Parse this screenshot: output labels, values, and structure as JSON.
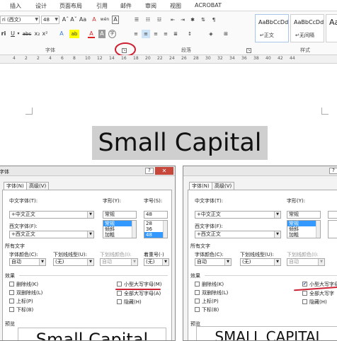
{
  "menu": {
    "tabs": [
      "插入",
      "设计",
      "页面布局",
      "引用",
      "邮件",
      "审阅",
      "视图",
      "ACROBAT"
    ]
  },
  "ribbon": {
    "font_name": "ri (西文)",
    "font_size": "48",
    "grow_font": "Aˆ",
    "shrink_font": "Aˇ",
    "change_case": "Aa",
    "clear_format": "A",
    "phonetic": "wén",
    "char_border": "A",
    "underline": "U",
    "strike": "abc",
    "subscript": "x₂",
    "superscript": "x²",
    "text_effect": "A",
    "highlight": "ab",
    "font_color": "A",
    "char_shading": "A",
    "enclose": "字",
    "group_font": "字体",
    "group_paragraph": "段落",
    "group_styles": "样式",
    "style1_sample": "AaBbCcDd",
    "style1_name": "↵正文",
    "style2_sample": "AaBbCcDd",
    "style2_name": "↵无间隔",
    "style3_sample": "Aa"
  },
  "ruler": {
    "ticks": [
      "4",
      "2",
      "2",
      "4",
      "6",
      "8",
      "10",
      "12",
      "14",
      "16",
      "18",
      "20",
      "22",
      "24",
      "26",
      "28",
      "30",
      "32",
      "34",
      "36",
      "38",
      "40",
      "42",
      "44"
    ]
  },
  "document": {
    "headline": "Small Capital"
  },
  "dialog_left": {
    "title": "字体",
    "tab_font": "字体(N)",
    "tab_advanced": "高级(V)",
    "label_cn_font": "中文字体(T):",
    "cn_font": "+中文正文",
    "label_style": "字形(Y):",
    "style_value": "常规",
    "style_list": [
      "常规",
      "倾斜",
      "加粗"
    ],
    "label_size": "字号(S):",
    "size_value": "48",
    "size_list": [
      "28",
      "36",
      "48"
    ],
    "label_west_font": "西文字体(F):",
    "west_font": "+西文正文",
    "section_all": "所有文字",
    "label_font_color": "字体颜色(C):",
    "font_color": "自动",
    "label_underline": "下划线线型(U):",
    "underline": "(无)",
    "label_underline_color": "下划线颜色(I):",
    "underline_color": "自动",
    "label_emphasis": "着重号(·)",
    "emphasis": "(无)",
    "section_effects": "效果",
    "eff_strike": "删除线(K)",
    "eff_dstrike": "双删除线(L)",
    "eff_super": "上标(P)",
    "eff_sub": "下标(B)",
    "eff_smallcaps": "小型大写字母(M)",
    "eff_allcaps": "全部大写字母(A)",
    "eff_hidden": "隐藏(H)",
    "section_preview": "预览",
    "preview_text": "Small Capital",
    "smallcaps_checked": false
  },
  "dialog_right": {
    "tab_font": "字体(N)",
    "tab_advanced": "高级(V)",
    "label_cn_font": "中文字体(T):",
    "cn_font": "+中文正文",
    "label_style": "字形(Y):",
    "style_value": "常规",
    "style_list": [
      "常规",
      "倾斜",
      "加粗"
    ],
    "label_west_font": "西文字体(F):",
    "west_font": "+西文正文",
    "section_all": "所有文字",
    "label_font_color": "字体颜色(C):",
    "font_color": "自动",
    "label_underline": "下划线线型(U):",
    "underline": "(无)",
    "label_underline_color": "下划线颜色(I):",
    "underline_color": "自动",
    "section_effects": "效果",
    "eff_strike": "删除线(K)",
    "eff_dstrike": "双删除线(L)",
    "eff_super": "上标(P)",
    "eff_sub": "下标(B)",
    "eff_smallcaps": "小型大写字母",
    "eff_allcaps": "全部大写字",
    "eff_hidden": "隐藏(H)",
    "section_preview": "预览",
    "preview_text": "SMALL CAPITAL",
    "smallcaps_checked": true,
    "check_mark": "✔"
  },
  "colors": {
    "annotation_red": "#cc2233",
    "selection_blue": "#3399ff",
    "close_red": "#c7483b"
  }
}
